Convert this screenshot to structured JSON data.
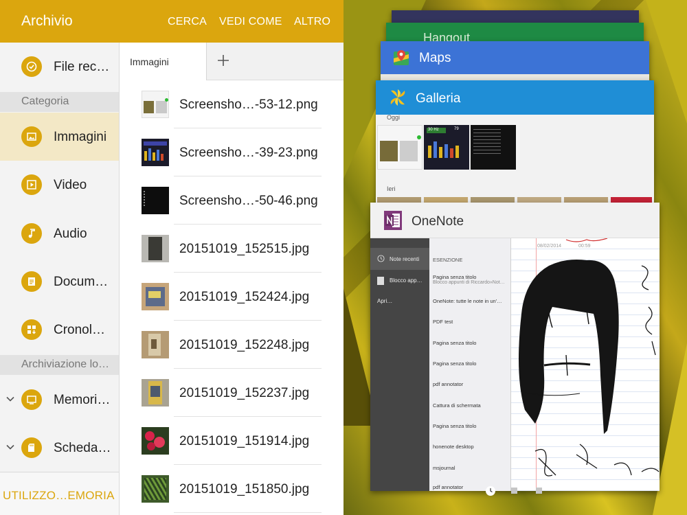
{
  "archivio": {
    "title": "Archivio",
    "actions": [
      "CERCA",
      "VEDI COME",
      "ALTRO"
    ],
    "nav": {
      "recent": "File rec…",
      "category_header": "Categoria",
      "categories": [
        "Immagini",
        "Video",
        "Audio",
        "Docum…",
        "Cronol…"
      ],
      "storage_header": "Archiviazione lo…",
      "storage": [
        "Memori…",
        "Scheda…"
      ],
      "footer": "UTILIZZO…EMORIA"
    },
    "tab_label": "Immagini",
    "files": [
      "Screensho…-53-12.png",
      "Screensho…-39-23.png",
      "Screensho…-50-46.png",
      "20151019_152515.jpg",
      "20151019_152424.jpg",
      "20151019_152248.jpg",
      "20151019_152237.jpg",
      "20151019_151914.jpg",
      "20151019_151850.jpg"
    ]
  },
  "recents": {
    "hangout": "Hangout",
    "maps": "Maps",
    "galleria": {
      "title": "Galleria",
      "today": "Oggi",
      "yesterday": "Ieri",
      "shot_readout": "30 Hz",
      "shot_value": "79"
    },
    "onenote": {
      "title": "OneNote",
      "sidebar": [
        "Note recenti",
        "Blocco app…",
        "Apri…"
      ],
      "list_header": "ESENZIONE",
      "list": [
        {
          "title": "Pagina senza titolo",
          "sub": "Blocco appunti di Riccardo»Not…"
        },
        {
          "title": "OneNote: tutte le note in un'…",
          "sub": ""
        },
        {
          "title": "PDF test",
          "sub": ""
        },
        {
          "title": "Pagina senza titolo",
          "sub": ""
        },
        {
          "title": "Pagina senza titolo",
          "sub": ""
        },
        {
          "title": "pdf annotator",
          "sub": ""
        },
        {
          "title": "Cattura di schermata",
          "sub": ""
        },
        {
          "title": "Pagina senza titolo",
          "sub": ""
        },
        {
          "title": "honenote desktop",
          "sub": ""
        },
        {
          "title": "msjournal",
          "sub": ""
        },
        {
          "title": "pdf annotator",
          "sub": ""
        }
      ],
      "note_date": "08/02/2014",
      "note_time": "00:59"
    }
  },
  "colors": {
    "accent": "#dba60e",
    "hangout": "#1e8a44",
    "maps": "#3c73d6",
    "galleria": "#1f8ed6",
    "onenote": "#80397b"
  }
}
